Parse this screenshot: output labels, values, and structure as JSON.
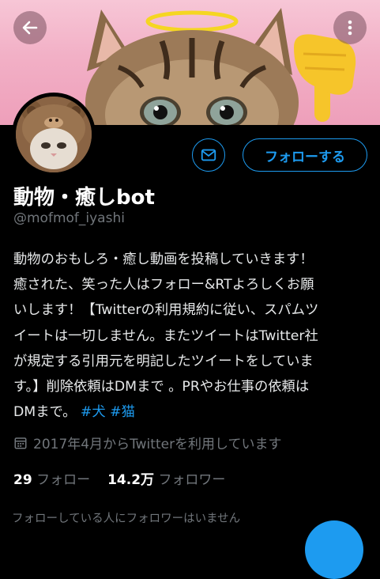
{
  "header": {
    "back_icon": "arrow-left-icon",
    "more_icon": "more-vertical-icon",
    "banner_colors": [
      "#f7c6d6",
      "#ee9fba"
    ]
  },
  "profile": {
    "display_name": "動物・癒しbot",
    "handle": "@mofmof_iyashi",
    "follow_button": "フォローする",
    "message_icon": "mail-icon",
    "bio_lines": [
      "動物のおもしろ・癒し動画を投稿していきます！",
      "癒された、笑った人はフォロー&RTよろしくお願",
      "いします！【Twitterの利用規約に従い、スパムツ",
      "イートは一切しません。またツイートはTwitter社",
      "が規定する引用元を明記したツイートをしていま",
      "す。】削除依頼はDMまで 。PRやお仕事の依頼は"
    ],
    "bio_last_text": "DMまで。",
    "hashtags": [
      "#犬",
      "#猫"
    ],
    "joined": "2017年4月からTwitterを利用しています",
    "following_count": "29",
    "following_label": "フォロー",
    "followers_count": "14.2万",
    "followers_label": "フォロワー",
    "mutual_note": "フォローしている人にフォロワーはいません"
  },
  "colors": {
    "accent": "#1d9bf0",
    "muted": "#71767b",
    "background": "#000000"
  }
}
